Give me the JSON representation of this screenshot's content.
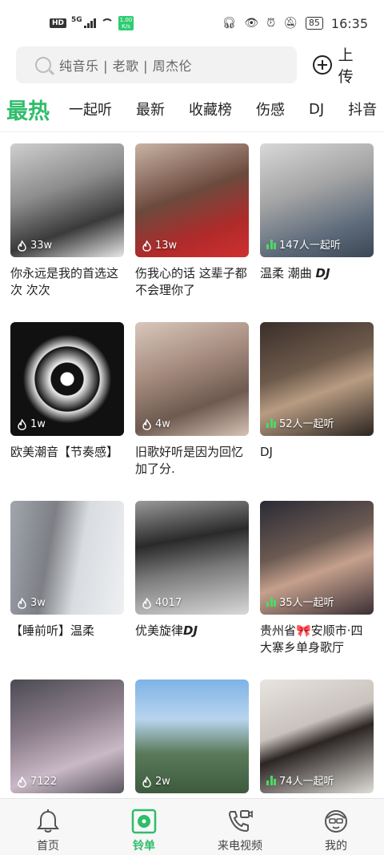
{
  "status_bar": {
    "hd": "HD",
    "signal_label": "5G",
    "net_speed_top": "1.00",
    "net_speed_bottom": "K/s",
    "battery": "85",
    "time": "16:35"
  },
  "search": {
    "placeholder": "纯音乐 | 老歌 | 周杰伦",
    "upload_label": "上传"
  },
  "tabs": [
    "最热",
    "一起听",
    "最新",
    "收藏榜",
    "伤感",
    "DJ",
    "抖音"
  ],
  "accent_color": "#2fbd6b",
  "cards": [
    {
      "count": "33w",
      "badge": "plays",
      "title": "你永远是我的首选这次 次次",
      "bg": "linear-gradient(160deg,#cfcfcf 0%,#8d8d8d 40%,#3a3a3a 70%,#e8e8e8 100%)"
    },
    {
      "count": "13w",
      "badge": "plays",
      "title": "伤我心的话 这辈子都不会理你了",
      "bg": "linear-gradient(160deg,#c9b3a5 0%,#6b4a3d 45%,#b02a2a 75%,#d03030 100%)"
    },
    {
      "count": "147人一起听",
      "badge": "listening",
      "title": "温柔 潮曲 ",
      "title_em": "DJ",
      "bg": "linear-gradient(160deg,#d8d8d8 0%,#a5a5a5 40%,#5d6a7a 75%,#3c4654 100%)"
    },
    {
      "count": "1w",
      "badge": "plays",
      "title": "欧美潮音【节奏感】",
      "bg": "radial-gradient(circle at 50% 50%,#ffffff 0%,#ffffff 8%,#111 9%,#111 20%,#eee 21%,#111 40%,#ddd 41%,#111 55%,#111 100%)"
    },
    {
      "count": "4w",
      "badge": "plays",
      "title": "旧歌好听是因为回忆加了分.",
      "bg": "linear-gradient(160deg,#d9c7bb 0%,#a48a7d 40%,#6e5a50 70%,#d7c4b6 100%)"
    },
    {
      "count": "52人一起听",
      "badge": "listening",
      "title": "DJ",
      "bg": "linear-gradient(160deg,#3a2f2a 0%,#6d5a4b 40%,#b89c82 60%,#2b2420 100%)"
    },
    {
      "count": "3w",
      "badge": "plays",
      "title": "【睡前听】温柔",
      "bg": "linear-gradient(100deg,#a1a6ad 0%,#7d7f85 35%,#d8dbe0 60%,#eef0f2 100%)"
    },
    {
      "count": "4017",
      "badge": "plays",
      "title": "优美旋律",
      "title_em": "DJ",
      "bg": "linear-gradient(170deg,#9a9a9a 0%,#2a2a2a 35%,#7a7a7a 60%,#d8d8d8 100%)"
    },
    {
      "count": "35人一起听",
      "badge": "listening",
      "title": "贵州省🎀安顺市·四大寨乡单身歌厅",
      "bg": "linear-gradient(160deg,#2a2a35 0%,#6b5a52 40%,#c5a08c 60%,#3a2f35 100%)"
    },
    {
      "count": "7122",
      "badge": "plays",
      "title": "",
      "bg": "linear-gradient(160deg,#4a4a52 0%,#8c7e8a 40%,#c9b8c5 70%,#5a5560 100%)"
    },
    {
      "count": "2w",
      "badge": "plays",
      "title": "",
      "bg": "linear-gradient(180deg,#7fb3e6 0%,#b8d4ee 35%,#5a7a5a 65%,#3d5a3d 100%)"
    },
    {
      "count": "74人一起听",
      "badge": "listening",
      "title": "",
      "bg": "linear-gradient(160deg,#e8e4e0 0%,#c9c2bd 40%,#2b2523 55%,#e0ddd8 100%)"
    }
  ],
  "bottom_nav": [
    {
      "label": "首页",
      "icon": "bell-icon",
      "active": false
    },
    {
      "label": "铃单",
      "icon": "disc-icon",
      "active": true
    },
    {
      "label": "来电视频",
      "icon": "phone-video-icon",
      "active": false
    },
    {
      "label": "我的",
      "icon": "avatar-icon",
      "active": false
    }
  ]
}
